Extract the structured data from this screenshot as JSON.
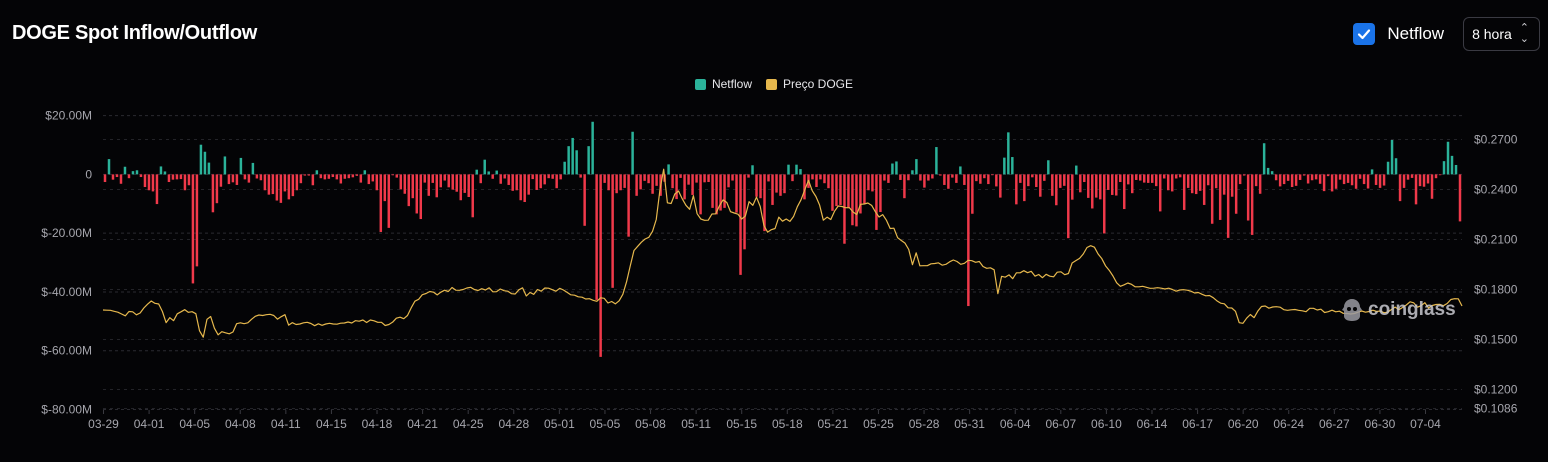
{
  "title": "DOGE Spot Inflow/Outflow",
  "controls": {
    "netflow_toggle": {
      "label": "Netflow",
      "checked": true
    },
    "interval": {
      "value": "8 hora"
    }
  },
  "watermark": "coinglass",
  "colors": {
    "positive": "#2bb39a",
    "negative": "#f0394a",
    "price": "#e6b84d",
    "accent": "#1a73e8"
  },
  "chart_data": {
    "type": "bar+line",
    "title": "DOGE Spot Inflow/Outflow",
    "legend": [
      {
        "name": "Netflow",
        "color": "#2bb39a"
      },
      {
        "name": "Preço DOGE",
        "color": "#e6b84d"
      }
    ],
    "legend_position": "top-center",
    "grid": true,
    "x_ticks": [
      "03-29",
      "04-01",
      "04-05",
      "04-08",
      "04-11",
      "04-15",
      "04-18",
      "04-21",
      "04-25",
      "04-28",
      "05-01",
      "05-05",
      "05-08",
      "05-11",
      "05-15",
      "05-18",
      "05-21",
      "05-25",
      "05-28",
      "05-31",
      "06-04",
      "06-07",
      "06-10",
      "06-14",
      "06-17",
      "06-20",
      "06-24",
      "06-27",
      "06-30",
      "07-04"
    ],
    "y_left": {
      "ticks": [
        "$20.00M",
        "0",
        "$-20.00M",
        "$-40.00M",
        "$-60.00M",
        "$-80.00M"
      ],
      "values": [
        20,
        0,
        -20,
        -40,
        -60,
        -80
      ],
      "range": [
        -80,
        20
      ],
      "unit": "M USD"
    },
    "y_right": {
      "ticks": [
        "$0.2700",
        "$0.2400",
        "$0.2100",
        "$0.1800",
        "$0.1500",
        "$0.1200",
        "$0.1086"
      ],
      "values": [
        0.27,
        0.24,
        0.21,
        0.18,
        0.15,
        0.12,
        0.1086
      ],
      "range": [
        0.1086,
        0.2808
      ]
    },
    "series": [
      {
        "name": "Netflow",
        "type": "bar",
        "values": [
          -2.6,
          5.2,
          -1.8,
          -0.9,
          -3.2,
          2.6,
          -1.3,
          1.1,
          1.4,
          -0.9,
          -4.3,
          -5.4,
          -5.8,
          -10.1,
          2.7,
          1.0,
          -2.6,
          -1.8,
          -1.7,
          -1.6,
          -5.4,
          -3.7,
          -37.1,
          -31.3,
          10.1,
          7.7,
          4.0,
          -12.9,
          -9.8,
          -4.2,
          6.1,
          -3.3,
          -2.7,
          -3.6,
          5.6,
          -1.7,
          -2.8,
          3.9,
          -1.4,
          -2.0,
          -5.4,
          -6.9,
          -6.7,
          -8.9,
          -9.7,
          -5.8,
          -8.5,
          -7.4,
          -5.4,
          -3.0,
          -0.4,
          -0.4,
          -3.7,
          1.4,
          -1.3,
          -1.7,
          -1.5,
          -0.9,
          -1.7,
          -3.1,
          -1.5,
          -1.3,
          -1.0,
          -0.5,
          -2.8,
          1.4,
          -3.3,
          -2.4,
          -5.4,
          -19.6,
          -9.1,
          -18.2,
          -0.3,
          -1.1,
          -5.1,
          -6.6,
          -10.8,
          -8.1,
          -13.3,
          -15.2,
          -2.8,
          -7.3,
          -2.9,
          -7.8,
          -4.4,
          -2.1,
          -4.4,
          -5.2,
          -5.9,
          -8.8,
          -6.3,
          -7.7,
          -14.6,
          1.6,
          -3.0,
          5.0,
          1.0,
          -1.5,
          1.3,
          -3.2,
          -1.4,
          -3.6,
          -5.6,
          -5.4,
          -8.8,
          -9.4,
          -6.9,
          -1.6,
          -5.3,
          -4.7,
          -3.4,
          -1.3,
          -1.5,
          -4.7,
          -1.7,
          4.3,
          9.6,
          12.4,
          8.2,
          -1.1,
          -17.5,
          9.6,
          17.9,
          -42.7,
          -62.1,
          -2.9,
          -5.4,
          -38.6,
          -6.4,
          -5.4,
          -4.6,
          -21.2,
          14.5,
          -7.3,
          -5.1,
          -2.2,
          -3.0,
          -6.6,
          -3.9,
          -7.3,
          -2.5,
          3.4,
          -4.7,
          -8.4,
          -1.2,
          -8.5,
          -3.5,
          -7.0,
          -2.8,
          -13.6,
          -2.7,
          -2.6,
          -11.4,
          -13.6,
          -12.3,
          -11.4,
          -4.4,
          -2.1,
          -13.0,
          -34.2,
          -25.5,
          -1.1,
          3.1,
          -7.6,
          -8.1,
          -19.3,
          -2.4,
          -10.4,
          -6.2,
          -7.3,
          -6.4,
          3.3,
          -2.3,
          3.3,
          1.8,
          -8.5,
          -4.6,
          -1.7,
          -4.3,
          -1.7,
          -3.0,
          -4.7,
          -12.4,
          -10.8,
          -10.4,
          -23.6,
          -11.5,
          -17.3,
          -17.7,
          -13.3,
          -10.1,
          -5.4,
          -5.8,
          -18.9,
          -12.8,
          -2.1,
          -2.9,
          3.7,
          4.4,
          -1.9,
          -8.1,
          -2.0,
          1.4,
          5.2,
          -2.1,
          -4.5,
          -2.1,
          -1.4,
          9.3,
          -0.4,
          -3.6,
          -4.9,
          -1.1,
          -2.9,
          2.7,
          -3.6,
          -44.8,
          -13.4,
          -2.3,
          -3.2,
          -1.3,
          -3.3,
          -0.2,
          -4.1,
          -7.9,
          5.7,
          14.3,
          5.9,
          -10.2,
          -2.9,
          -9.1,
          -4.0,
          -1.0,
          -4.3,
          -7.6,
          -2.2,
          4.8,
          -7.3,
          -10.5,
          -4.6,
          -3.9,
          -21.7,
          -8.6,
          3.0,
          -6.1,
          -2.6,
          -8.0,
          -11.6,
          -7.9,
          -8.5,
          -20.1,
          -5.3,
          -7.0,
          -7.2,
          -2.6,
          -11.8,
          -3.4,
          -6.4,
          -1.9,
          -2.1,
          -2.8,
          -2.9,
          -2.9,
          -4.0,
          -12.6,
          -1.4,
          -5.4,
          -5.8,
          -1.4,
          -1.0,
          -12.1,
          -4.6,
          -6.4,
          -6.7,
          -5.6,
          -10.4,
          -3.7,
          -16.8,
          -4.7,
          -15.5,
          -6.9,
          -21.6,
          -7.6,
          -13.4,
          -3.3,
          -0.4,
          -15.7,
          -20.6,
          -4.0,
          -6.6,
          10.6,
          2.2,
          1.1,
          -2.0,
          -4.1,
          -3.3,
          -2.2,
          -4.3,
          -3.9,
          -1.9,
          -0.4,
          -3.1,
          -2.0,
          -1.7,
          -3.2,
          -5.7,
          -0.6,
          -5.8,
          -4.9,
          -1.8,
          -3.3,
          -2.9,
          -3.7,
          -4.9,
          -1.5,
          -3.3,
          -4.8,
          1.7,
          -3.6,
          -4.6,
          -3.8,
          4.3,
          11.7,
          5.5,
          -9.1,
          -4.6,
          -1.8,
          -1.2,
          -10.2,
          -4.0,
          -4.2,
          -3.1,
          -8.3,
          -1.3,
          -0.1,
          4.5,
          11.1,
          6.3,
          3.2,
          -16.0
        ]
      },
      {
        "name": "Preço DOGE",
        "type": "line",
        "values": [
          0.1677,
          0.1676,
          0.1675,
          0.1669,
          0.1664,
          0.1653,
          0.1642,
          0.1668,
          0.1666,
          0.1648,
          0.1659,
          0.1689,
          0.1712,
          0.1731,
          0.1717,
          0.1713,
          0.1668,
          0.1601,
          0.1631,
          0.1613,
          0.1654,
          0.1666,
          0.1679,
          0.1663,
          0.1667,
          0.1655,
          0.1552,
          0.1514,
          0.1621,
          0.1638,
          0.1568,
          0.1528,
          0.1547,
          0.154,
          0.1534,
          0.1545,
          0.1595,
          0.16,
          0.1595,
          0.16,
          0.1621,
          0.1639,
          0.1647,
          0.1644,
          0.1649,
          0.1651,
          0.1644,
          0.1622,
          0.1637,
          0.1649,
          0.1586,
          0.1601,
          0.159,
          0.1593,
          0.16,
          0.1603,
          0.1596,
          0.1583,
          0.1594,
          0.1585,
          0.1593,
          0.1597,
          0.1593,
          0.1592,
          0.1598,
          0.1599,
          0.1605,
          0.1599,
          0.1613,
          0.161,
          0.1617,
          0.1602,
          0.1617,
          0.1612,
          0.1603,
          0.1603,
          0.1584,
          0.159,
          0.1604,
          0.1628,
          0.1634,
          0.1625,
          0.1644,
          0.169,
          0.173,
          0.1741,
          0.1769,
          0.1776,
          0.1788,
          0.1784,
          0.1768,
          0.1784,
          0.1796,
          0.1788,
          0.1812,
          0.1796,
          0.1795,
          0.18,
          0.1809,
          0.1813,
          0.18,
          0.1794,
          0.1805,
          0.1797,
          0.181,
          0.1786,
          0.1787,
          0.1803,
          0.1793,
          0.179,
          0.1775,
          0.1773,
          0.1798,
          0.181,
          0.1761,
          0.1782,
          0.1771,
          0.18,
          0.179,
          0.1809,
          0.1808,
          0.1799,
          0.179,
          0.1807,
          0.1797,
          0.1783,
          0.1768,
          0.1766,
          0.1756,
          0.1754,
          0.1743,
          0.1745,
          0.1735,
          0.1729,
          0.175,
          0.1747,
          0.1719,
          0.1728,
          0.1714,
          0.1732,
          0.1771,
          0.1846,
          0.1942,
          0.2034,
          0.2059,
          0.2084,
          0.2103,
          0.2113,
          0.2149,
          0.222,
          0.2399,
          0.2522,
          0.232,
          0.2316,
          0.2373,
          0.2391,
          0.2344,
          0.2305,
          0.2281,
          0.2363,
          0.2255,
          0.2223,
          0.2215,
          0.2216,
          0.2253,
          0.2254,
          0.2302,
          0.2338,
          0.2322,
          0.2267,
          0.2259,
          0.2252,
          0.2223,
          0.2241,
          0.2327,
          0.2305,
          0.2354,
          0.2298,
          0.2184,
          0.2144,
          0.2159,
          0.2166,
          0.2234,
          0.221,
          0.2223,
          0.2209,
          0.2239,
          0.2297,
          0.2339,
          0.2398,
          0.2455,
          0.2393,
          0.2358,
          0.2306,
          0.2216,
          0.2234,
          0.222,
          0.2269,
          0.2301,
          0.2298,
          0.2291,
          0.2291,
          0.2265,
          0.225,
          0.2311,
          0.2313,
          0.2319,
          0.2305,
          0.2267,
          0.2235,
          0.2249,
          0.2215,
          0.2166,
          0.2168,
          0.2111,
          0.2094,
          0.2078,
          0.204,
          0.1949,
          0.202,
          0.1942,
          0.1943,
          0.1943,
          0.1954,
          0.1956,
          0.196,
          0.1946,
          0.1951,
          0.1966,
          0.1977,
          0.1968,
          0.1951,
          0.1957,
          0.1975,
          0.1973,
          0.1963,
          0.1968,
          0.1938,
          0.1927,
          0.193,
          0.1918,
          0.1775,
          0.1879,
          0.1874,
          0.1888,
          0.1865,
          0.19,
          0.19,
          0.1913,
          0.1901,
          0.1909,
          0.188,
          0.189,
          0.1871,
          0.1891,
          0.188,
          0.1876,
          0.1904,
          0.1906,
          0.1889,
          0.1896,
          0.1959,
          0.1973,
          0.1987,
          0.2013,
          0.2052,
          0.2063,
          0.2054,
          0.2013,
          0.1985,
          0.1942,
          0.1915,
          0.1881,
          0.184,
          0.1819,
          0.1828,
          0.1839,
          0.1831,
          0.1816,
          0.1816,
          0.1819,
          0.1813,
          0.1807,
          0.1808,
          0.1811,
          0.1808,
          0.1803,
          0.1808,
          0.18,
          0.179,
          0.1797,
          0.1799,
          0.1796,
          0.179,
          0.1779,
          0.1782,
          0.1771,
          0.1762,
          0.1764,
          0.1751,
          0.1732,
          0.1718,
          0.1714,
          0.169,
          0.1689,
          0.1669,
          0.1601,
          0.1597,
          0.1628,
          0.165,
          0.1631,
          0.167,
          0.1698,
          0.1701,
          0.1688,
          0.1695,
          0.1697,
          0.1694,
          0.1679,
          0.1675,
          0.1678,
          0.168,
          0.1675,
          0.1672,
          0.1667,
          0.1687,
          0.1687,
          0.1677,
          0.1682,
          0.1662,
          0.1667,
          0.1676,
          0.1666,
          0.167,
          0.1657,
          0.1656,
          0.1653,
          0.1656,
          0.1664,
          0.1671,
          0.1664,
          0.1668,
          0.1676,
          0.1668,
          0.1671,
          0.1661,
          0.1664,
          0.168,
          0.1694,
          0.1679,
          0.1692,
          0.1707,
          0.1726,
          0.172,
          0.1694,
          0.1703,
          0.1721,
          0.1689,
          0.1704,
          0.171,
          0.1711,
          0.1703,
          0.1716,
          0.174,
          0.1745,
          0.1744,
          0.1701
        ]
      }
    ]
  }
}
